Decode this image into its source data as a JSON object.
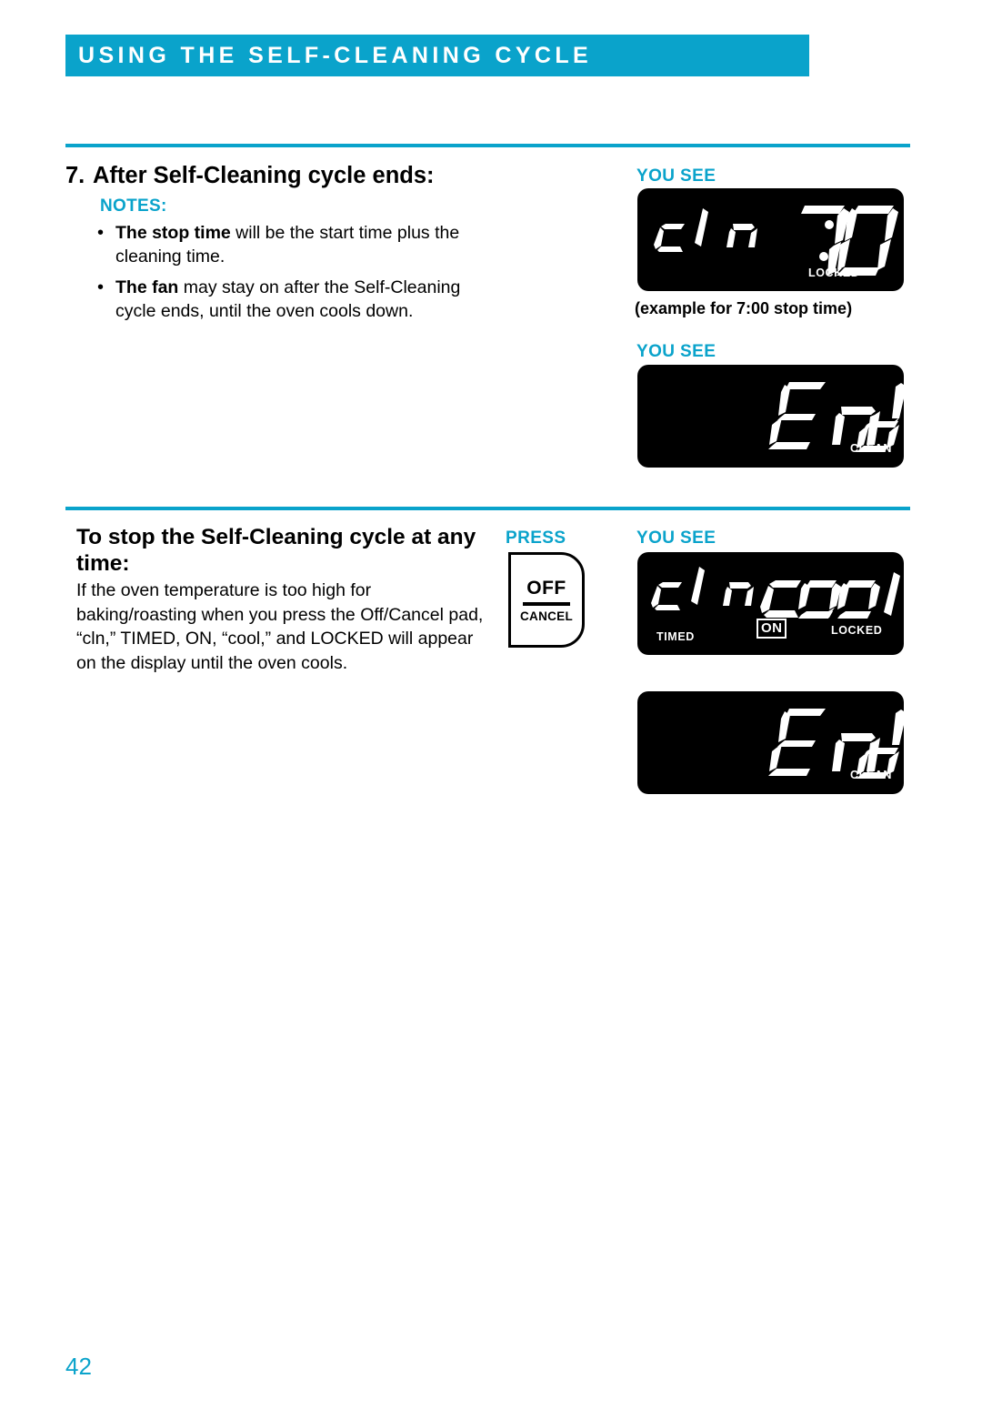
{
  "header": {
    "title": "USING THE SELF-CLEANING CYCLE",
    "bar_color": "#0AA3CB"
  },
  "page": {
    "number": "42",
    "number_color": "#0AA3CB",
    "background": "#ffffff"
  },
  "section_one": {
    "step_number": "7.",
    "heading": "After Self-Cleaning cycle ends:",
    "notes_label": "NOTES:",
    "bullets": [
      {
        "bold": "The stop time",
        "rest": " will be the start time plus the cleaning time."
      },
      {
        "bold": "The fan",
        "rest": " may stay on after the Self-Cleaning cycle ends, until the oven cools down."
      }
    ],
    "you_see_label": "YOU SEE",
    "caption": "(example for 7:00 stop time)",
    "second_you_see_label": "YOU SEE"
  },
  "section_two": {
    "heading": "To stop the Self-Cleaning cycle at any time:",
    "body": "If the oven temperature is too high for baking/roasting when you press the Off/Cancel pad, “cln,” TIMED, ON, “cool,” and LOCKED will appear on the display until the oven cools.",
    "press_label": "PRESS",
    "you_see_label": "YOU SEE",
    "pad": {
      "primary": "OFF",
      "secondary": "CANCEL"
    }
  },
  "displays": [
    {
      "id": "display-cln-700",
      "segments": "cln 7:00",
      "left_text": "cln",
      "right_text": "7:00",
      "annunciators": [
        "LOCKED"
      ],
      "boxed_annunciators": [],
      "background": "#000000",
      "segment_color": "#ffffff"
    },
    {
      "id": "display-end-clean-top",
      "segments": "End",
      "left_text": "",
      "right_text": "End",
      "annunciators": [
        "CLEAN"
      ],
      "boxed_annunciators": [],
      "background": "#000000",
      "segment_color": "#ffffff"
    },
    {
      "id": "display-cln-cool",
      "segments": "cln cool",
      "left_text": "cln",
      "right_text": "cool",
      "annunciators": [
        "TIMED",
        "LOCKED"
      ],
      "boxed_annunciators": [
        "ON"
      ],
      "background": "#000000",
      "segment_color": "#ffffff"
    },
    {
      "id": "display-end-clean-bottom",
      "segments": "End",
      "left_text": "",
      "right_text": "End",
      "annunciators": [
        "CLEAN"
      ],
      "boxed_annunciators": [],
      "background": "#000000",
      "segment_color": "#ffffff"
    }
  ]
}
